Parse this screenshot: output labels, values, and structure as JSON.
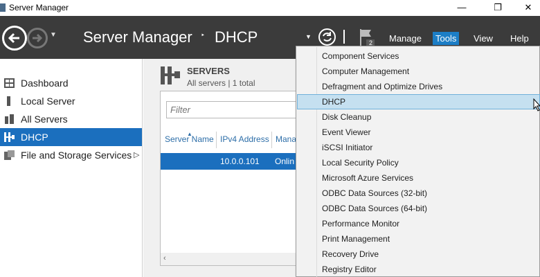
{
  "window": {
    "title": "Server Manager",
    "minimize_glyph": "—",
    "restore_glyph": "❐",
    "close_glyph": "✕"
  },
  "header": {
    "breadcrumb_app": "Server Manager",
    "breadcrumb_separator": "‣",
    "breadcrumb_page": "DHCP",
    "dropdown_glyph": "▼",
    "notification_count": "2",
    "menu": [
      "Manage",
      "Tools",
      "View",
      "Help"
    ],
    "active_menu": "Tools",
    "background_color": "#3b3b3b",
    "accent_color": "#1c7ec6"
  },
  "sidebar": {
    "items": [
      {
        "label": "Dashboard",
        "icon": "dashboard-icon"
      },
      {
        "label": "Local Server",
        "icon": "local-server-icon"
      },
      {
        "label": "All Servers",
        "icon": "all-servers-icon"
      },
      {
        "label": "DHCP",
        "icon": "dhcp-icon",
        "selected": true
      },
      {
        "label": "File and Storage Services",
        "icon": "file-storage-icon",
        "expand_glyph": "▷"
      }
    ],
    "selection_color": "#1b6fbe"
  },
  "servers": {
    "title": "SERVERS",
    "subtitle": "All servers | 1 total",
    "filter_placeholder": "Filter",
    "columns": [
      "Server Name",
      "IPv4 Address",
      "Mana"
    ],
    "rows": [
      {
        "server_name": "",
        "ipv4": "10.0.0.101",
        "status": "Onlin"
      }
    ],
    "scroll_left_glyph": "‹"
  },
  "tools_menu": {
    "items": [
      "Component Services",
      "Computer Management",
      "Defragment and Optimize Drives",
      "DHCP",
      "Disk Cleanup",
      "Event Viewer",
      "iSCSI Initiator",
      "Local Security Policy",
      "Microsoft Azure Services",
      "ODBC Data Sources (32-bit)",
      "ODBC Data Sources (64-bit)",
      "Performance Monitor",
      "Print Management",
      "Recovery Drive",
      "Registry Editor"
    ],
    "hovered_item": "DHCP",
    "hover_color": "#c5e0f0"
  }
}
